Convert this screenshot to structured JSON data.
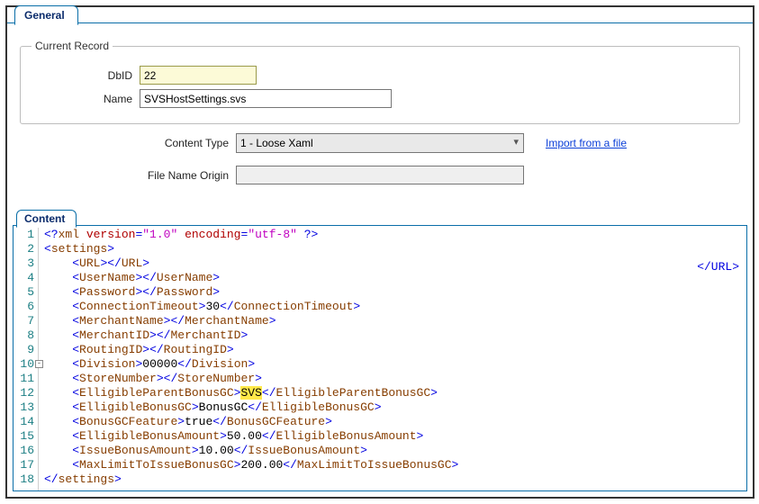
{
  "tabs": {
    "general": "General",
    "content": "Content"
  },
  "fieldset": {
    "legend": "Current Record",
    "dbid_label": "DbID",
    "dbid_value": "22",
    "name_label": "Name",
    "name_value": "SVSHostSettings.svs"
  },
  "mid": {
    "content_type_label": "Content Type",
    "content_type_value": "1 - Loose Xaml",
    "file_name_origin_label": "File Name Origin",
    "file_name_origin_value": "",
    "import_link": "Import from a file"
  },
  "editor": {
    "line_count": 18,
    "fold_line": 10,
    "highlight": "SVS",
    "extra_tag_right": "</URL>",
    "xml": {
      "decl": {
        "version": "1.0",
        "encoding": "utf-8"
      },
      "root": "settings",
      "fields": [
        {
          "tag": "URL",
          "value": ""
        },
        {
          "tag": "UserName",
          "value": ""
        },
        {
          "tag": "Password",
          "value": ""
        },
        {
          "tag": "ConnectionTimeout",
          "value": "30"
        },
        {
          "tag": "MerchantName",
          "value": ""
        },
        {
          "tag": "MerchantID",
          "value": ""
        },
        {
          "tag": "RoutingID",
          "value": ""
        },
        {
          "tag": "Division",
          "value": "00000"
        },
        {
          "tag": "StoreNumber",
          "value": ""
        },
        {
          "tag": "ElligibleParentBonusGC",
          "value": "SVS"
        },
        {
          "tag": "ElligibleBonusGC",
          "value": "BonusGC"
        },
        {
          "tag": "BonusGCFeature",
          "value": "true"
        },
        {
          "tag": "ElligibleBonusAmount",
          "value": "50.00"
        },
        {
          "tag": "IssueBonusAmount",
          "value": "10.00"
        },
        {
          "tag": "MaxLimitToIssueBonusGC",
          "value": "200.00"
        }
      ]
    }
  }
}
